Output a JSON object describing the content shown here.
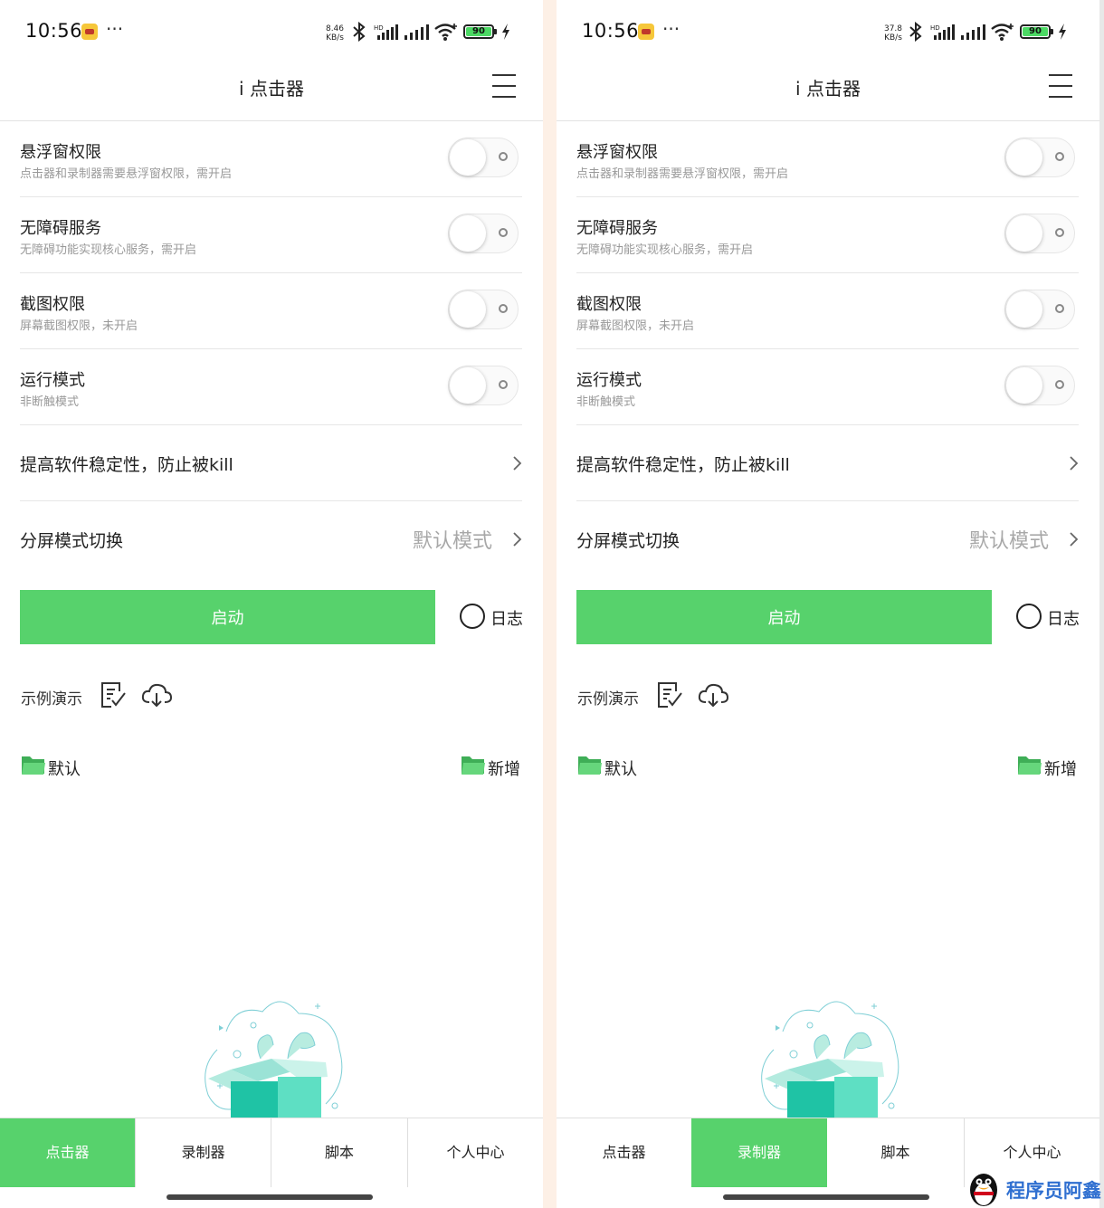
{
  "colors": {
    "accent": "#57d26c",
    "text": "#222222",
    "muted": "#999999",
    "watermark": "#2f6fd0"
  },
  "status": {
    "time": "10:56",
    "speed_left": {
      "value": "8.46",
      "unit": "KB/s"
    },
    "speed_right": {
      "value": "37.8",
      "unit": "KB/s"
    },
    "hd": "HD",
    "battery": "90"
  },
  "app": {
    "title": "i 点击器"
  },
  "settings": [
    {
      "title": "悬浮窗权限",
      "subtitle": "点击器和录制器需要悬浮窗权限，需开启",
      "enabled": false
    },
    {
      "title": "无障碍服务",
      "subtitle": "无障碍功能实现核心服务，需开启",
      "enabled": false
    },
    {
      "title": "截图权限",
      "subtitle": "屏幕截图权限，未开启",
      "enabled": false
    },
    {
      "title": "运行模式",
      "subtitle": "非断触模式",
      "enabled": false
    }
  ],
  "stability": {
    "title": "提高软件稳定性，防止被kill"
  },
  "split_mode": {
    "title": "分屏模式切换",
    "value": "默认模式"
  },
  "start_button": "启动",
  "log_label": "日志",
  "demo_label": "示例演示",
  "icons": {
    "doc": "document-check-icon",
    "cloud": "cloud-download-icon",
    "folder": "folder-icon",
    "chevron": "chevron-right-icon",
    "menu": "hamburger-menu-icon"
  },
  "folders": {
    "default": "默认",
    "add": "新增"
  },
  "nav": {
    "tabs": [
      "点击器",
      "录制器",
      "脚本",
      "个人中心"
    ],
    "left_active": 0,
    "right_active": 1
  },
  "watermark": "程序员阿鑫"
}
